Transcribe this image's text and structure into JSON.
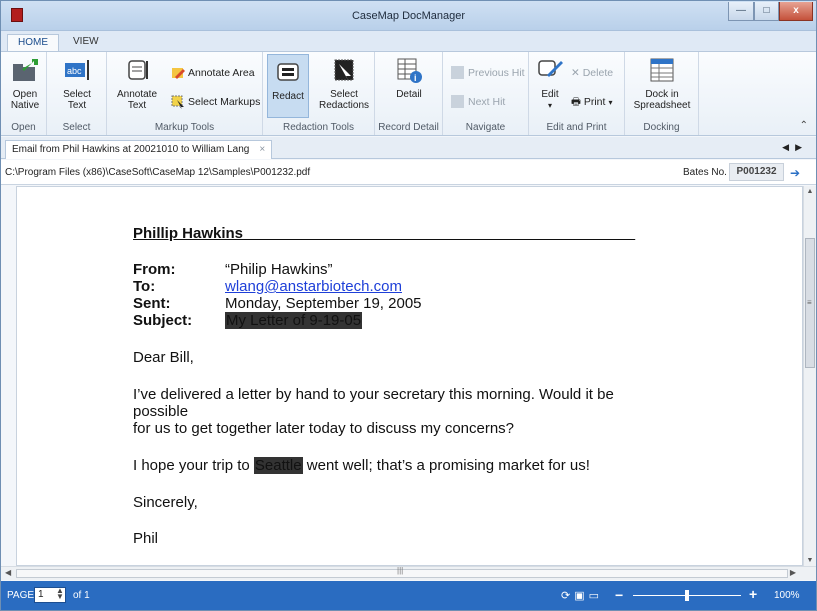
{
  "window": {
    "title": "CaseMap DocManager",
    "min_label": "—",
    "max_label": "□",
    "close_label": "x"
  },
  "tabs": [
    "HOME",
    "VIEW"
  ],
  "ribbon": {
    "groups": [
      "Open",
      "Select",
      "Markup Tools",
      "Redaction Tools",
      "Record Detail",
      "Navigate",
      "Edit and Print",
      "Docking"
    ],
    "open_native": "Open\nNative",
    "select_text": "Select\nText",
    "annotate_text": "Annotate\nText",
    "annotate_area": "Annotate Area",
    "select_markups": "Select Markups",
    "redact": "Redact",
    "select_redactions": "Select\nRedactions",
    "detail": "Detail",
    "previous_hit": "Previous Hit",
    "next_hit": "Next Hit",
    "edit": "Edit",
    "delete": "Delete",
    "print": "Print",
    "dock": "Dock in\nSpreadsheet"
  },
  "doc_tab": {
    "label": "Email from Phil Hawkins at 20021010 to William Lang",
    "close": "×"
  },
  "path": "C:\\Program Files (x86)\\CaseSoft\\CaseMap 12\\Samples\\P001232.pdf",
  "bates": {
    "label": "Bates No.",
    "value": "P001232"
  },
  "document": {
    "heading": "Phillip Hawkins",
    "heading_fill": "_______________________________________________",
    "from_label": "From:",
    "from": "“Philip Hawkins”",
    "to_label": "To:",
    "to": "wlang@anstarbiotech.com",
    "sent_label": "Sent:",
    "sent": "Monday, September 19, 2005",
    "subject_label": "Subject:",
    "subject": "My Letter of 9-19-05",
    "greeting": "Dear Bill,",
    "p1_line1": "I’ve delivered a letter by hand to your secretary this morning.  Would it be",
    "p1_line2": "possible",
    "p1_line3": "for us to get together later today to discuss my concerns?",
    "p2_before": "I hope your trip to ",
    "p2_redacted": "Seattle",
    "p2_after": " went well; that’s a promising market for us!",
    "closing": "Sincerely,",
    "signature": "Phil"
  },
  "status": {
    "page_label": "PAGE",
    "page": "1",
    "of": "of 1",
    "zoom": "100%",
    "zoom_level": 0.5
  }
}
